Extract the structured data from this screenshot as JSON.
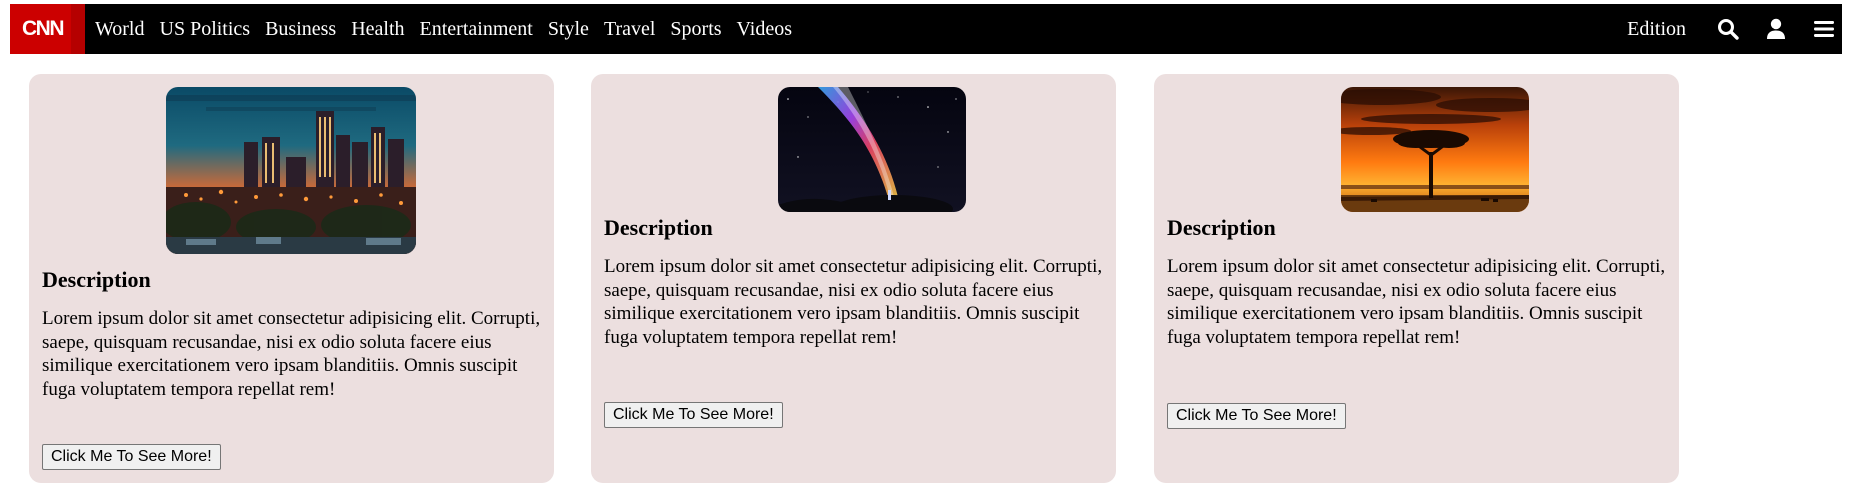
{
  "header": {
    "logo": "CNN",
    "nav_items": [
      "World",
      "US Politics",
      "Business",
      "Health",
      "Entertainment",
      "Style",
      "Travel",
      "Sports",
      "Videos"
    ],
    "edition_label": "Edition",
    "icons": [
      "search-icon",
      "user-icon",
      "menu-icon"
    ]
  },
  "cards": [
    {
      "image": "city-night-skyline-image",
      "title": "Description",
      "text": "Lorem ipsum dolor sit amet consectetur adipisicing elit. Corrupti, saepe, quisquam recusandae, nisi ex odio soluta facere eius similique exercitationem vero ipsam blanditiis. Omnis suscipit fuga voluptatem tempora repellat rem!",
      "button_label": "Click Me To See More!"
    },
    {
      "image": "aurora-night-sky-image",
      "title": "Description",
      "text": "Lorem ipsum dolor sit amet consectetur adipisicing elit. Corrupti, saepe, quisquam recusandae, nisi ex odio soluta facere eius similique exercitationem vero ipsam blanditiis. Omnis suscipit fuga voluptatem tempora repellat rem!",
      "button_label": "Click Me To See More!"
    },
    {
      "image": "savanna-sunset-tree-image",
      "title": "Description",
      "text": "Lorem ipsum dolor sit amet consectetur adipisicing elit. Corrupti, saepe, quisquam recusandae, nisi ex odio soluta facere eius similique exercitationem vero ipsam blanditiis. Omnis suscipit fuga voluptatem tempora repellat rem!",
      "button_label": "Click Me To See More!"
    }
  ],
  "colors": {
    "nav_background": "#000000",
    "logo_red": "#cc0000",
    "card_background": "#ecdfdf"
  }
}
